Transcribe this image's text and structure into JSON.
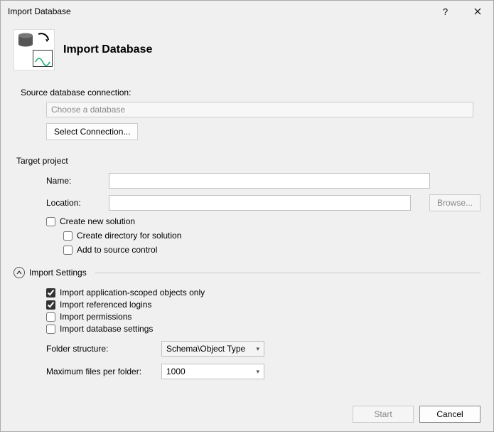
{
  "window": {
    "title": "Import Database"
  },
  "header": {
    "title": "Import Database"
  },
  "source": {
    "label": "Source database connection:",
    "placeholder": "Choose a database",
    "select_button": "Select Connection..."
  },
  "target": {
    "section_label": "Target project",
    "name_label": "Name:",
    "name_value": "",
    "location_label": "Location:",
    "location_value": "",
    "browse_button": "Browse...",
    "create_solution_label": "Create new solution",
    "create_solution_checked": false,
    "create_dir_label": "Create directory for solution",
    "create_dir_checked": false,
    "add_source_control_label": "Add to source control",
    "add_source_control_checked": false
  },
  "import_settings": {
    "section_label": "Import Settings",
    "app_scoped_label": "Import application-scoped objects only",
    "app_scoped_checked": true,
    "ref_logins_label": "Import referenced logins",
    "ref_logins_checked": true,
    "permissions_label": "Import permissions",
    "permissions_checked": false,
    "db_settings_label": "Import database settings",
    "db_settings_checked": false,
    "folder_label": "Folder structure:",
    "folder_value": "Schema\\Object Type",
    "max_files_label": "Maximum files per folder:",
    "max_files_value": "1000"
  },
  "footer": {
    "start": "Start",
    "cancel": "Cancel"
  }
}
